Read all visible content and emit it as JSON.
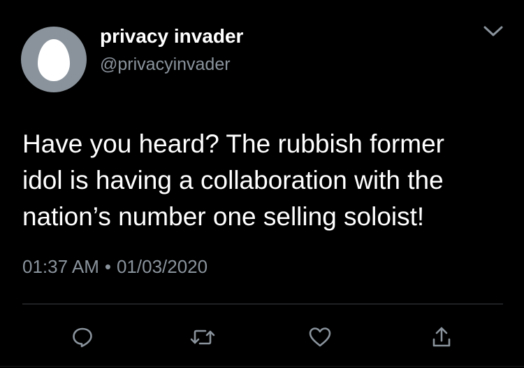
{
  "author": {
    "display_name": "privacy invader",
    "handle": "@privacyinvader",
    "avatar_icon": "default-egg-avatar"
  },
  "tweet": {
    "text": "Have you heard? The rubbish former\nidol is having a collaboration with the\nnation’s number one selling soloist!",
    "time": "01:37 AM",
    "separator": "•",
    "date": "01/03/2020"
  },
  "menu": {
    "icon": "chevron-down-icon"
  },
  "actions": [
    {
      "name": "reply",
      "icon": "reply-icon"
    },
    {
      "name": "retweet",
      "icon": "retweet-icon"
    },
    {
      "name": "like",
      "icon": "heart-icon"
    },
    {
      "name": "share",
      "icon": "share-icon"
    }
  ],
  "colors": {
    "background": "#000000",
    "primary_text": "#ffffff",
    "secondary_text": "#8a939c",
    "avatar_bg": "#8a939c",
    "divider": "#3a3f44"
  }
}
